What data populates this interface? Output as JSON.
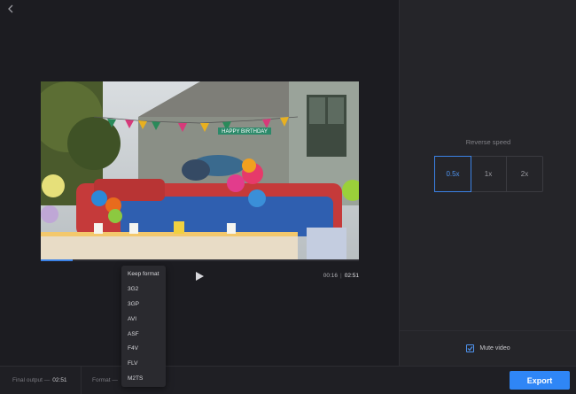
{
  "player": {
    "current_time": "00:16",
    "separator": "|",
    "total_time": "02:51",
    "progress": 0.1
  },
  "reverse_speed": {
    "label": "Reverse speed",
    "options": [
      "0.5x",
      "1x",
      "2x"
    ],
    "selected": "0.5x"
  },
  "mute": {
    "label": "Mute video",
    "checked": true
  },
  "footer": {
    "final_output_label": "Final output —",
    "final_output_value": "02:51",
    "format_label": "Format —"
  },
  "export_label": "Export",
  "format_dropdown": {
    "items": [
      "Keep format",
      "3G2",
      "3GP",
      "AVI",
      "ASF",
      "F4V",
      "FLV",
      "M2TS"
    ]
  },
  "video_frame": {
    "banner_text": "HAPPY BIRTHDAY"
  },
  "colors": {
    "accent": "#2f86f6",
    "panel": "#252529",
    "background": "#1c1c21"
  },
  "icons": [
    "back-icon",
    "play-icon",
    "check-icon"
  ]
}
